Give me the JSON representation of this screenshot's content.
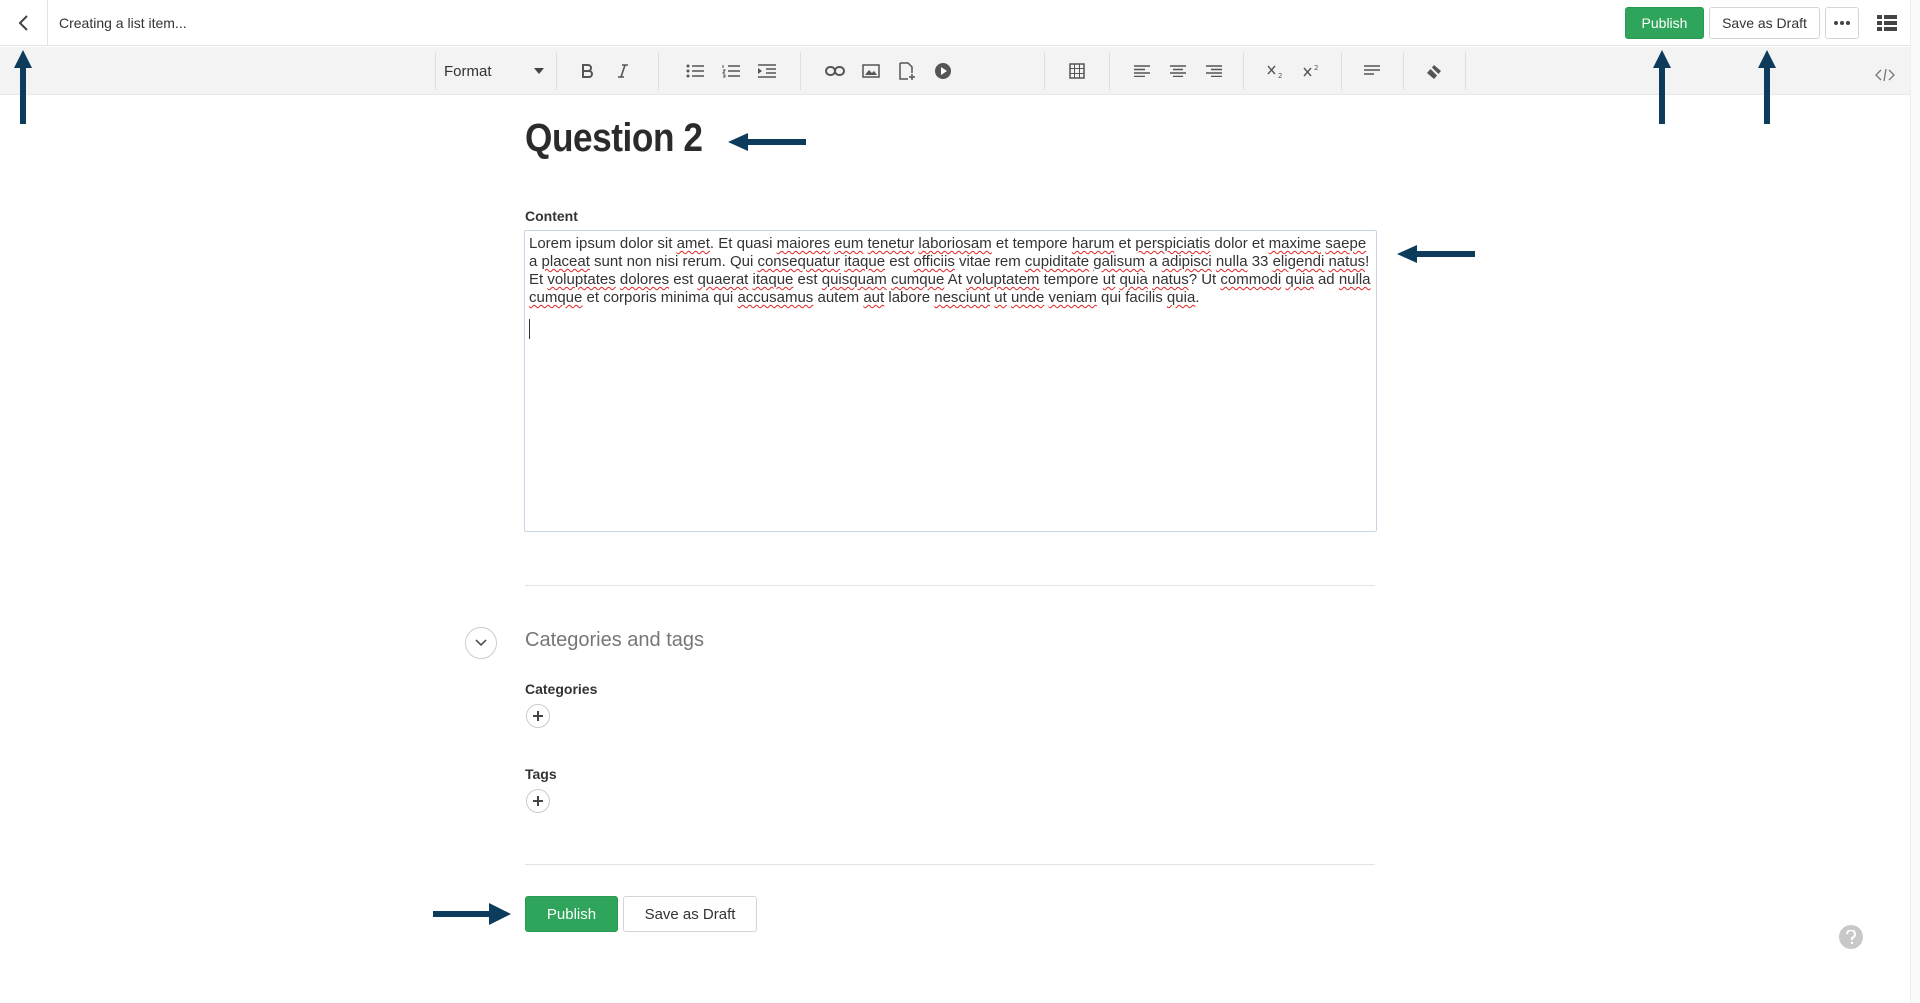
{
  "header": {
    "status_text": "Creating a list item...",
    "publish_label": "Publish",
    "draft_label": "Save as Draft"
  },
  "toolbar": {
    "format_label": "Format"
  },
  "page": {
    "title": "Question 2",
    "content_label": "Content",
    "content_segments": [
      "Lorem ipsum dolor sit ",
      "amet",
      ". Et quasi ",
      "maiores",
      " ",
      "eum",
      " ",
      "tenetur",
      " ",
      "laboriosam",
      " et tempore ",
      "harum",
      " et ",
      "perspiciatis",
      " dolor et ",
      "maxime",
      " ",
      "saepe",
      " a ",
      "placeat",
      " sunt non nisi rerum. Qui ",
      "consequatur",
      " ",
      "itaque",
      " est ",
      "officiis",
      " vitae rem ",
      "cupiditate",
      " ",
      "galisum",
      " a ",
      "adipisci",
      " ",
      "nulla",
      " 33 ",
      "eligendi",
      " ",
      "natus",
      "! Et ",
      "voluptates",
      " ",
      "dolores",
      " est ",
      "quaerat",
      " ",
      "itaque",
      " est ",
      "quisquam",
      " ",
      "cumque",
      " At ",
      "voluptatem",
      " tempore ",
      "ut",
      " ",
      "quia",
      " ",
      "natus",
      "? Ut ",
      "commodi",
      " ",
      "quia",
      " ad ",
      "nulla",
      " ",
      "cumque",
      " et corporis minima qui ",
      "accusamus",
      " autem ",
      "aut",
      " labore ",
      "nesciunt",
      " ",
      "ut",
      " ",
      "unde",
      " ",
      "veniam",
      " qui facilis ",
      "quia",
      "."
    ],
    "section_title": "Categories and tags",
    "categories_label": "Categories",
    "tags_label": "Tags"
  },
  "footer": {
    "publish_label": "Publish",
    "draft_label": "Save as Draft"
  },
  "colors": {
    "primary": "#2ea55a",
    "arrow": "#0d3b5c"
  }
}
